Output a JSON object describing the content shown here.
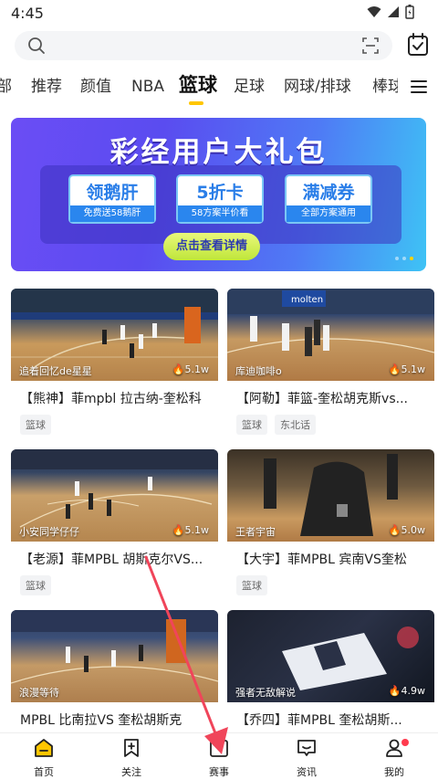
{
  "status_bar": {
    "time": "4:45"
  },
  "search": {
    "placeholder": ""
  },
  "tabs": [
    {
      "label": "部"
    },
    {
      "label": "推荐"
    },
    {
      "label": "颜值"
    },
    {
      "label": "NBA"
    },
    {
      "label": "篮球",
      "active": true
    },
    {
      "label": "足球"
    },
    {
      "label": "网球/排球"
    },
    {
      "label": "棒球"
    }
  ],
  "banner": {
    "title": "彩经用户大礼包",
    "coupons": [
      {
        "title": "领鹅肝",
        "subtitle": "免费送58鹅肝"
      },
      {
        "title": "5折卡",
        "subtitle": "58方案半价看"
      },
      {
        "title": "满减券",
        "subtitle": "全部方案通用"
      }
    ],
    "cta": "点击查看详情",
    "page_dots": 3,
    "active_dot": 2
  },
  "videos": [
    {
      "author": "追着回忆de星星",
      "views": "5.1w",
      "title": "【熊神】菲mpbl 拉古纳-奎松科",
      "tags": [
        "篮球"
      ]
    },
    {
      "author": "库迪咖啡o",
      "views": "5.1w",
      "title": "【阿勒】菲篮-奎松胡克斯vs...",
      "tags": [
        "篮球",
        "东北话"
      ]
    },
    {
      "author": "小安同学仔仔",
      "views": "5.1w",
      "title": "【老源】菲MPBL 胡斯克尔VS...",
      "tags": [
        "篮球"
      ]
    },
    {
      "author": "王者宇宙",
      "views": "5.0w",
      "title": "【大宇】菲MPBL 宾南VS奎松",
      "tags": [
        "篮球"
      ]
    },
    {
      "author": "浪漫等待",
      "views": "",
      "title": "MPBL 比南拉VS 奎松胡斯克",
      "tags": []
    },
    {
      "author": "强者无敌解说",
      "views": "4.9w",
      "title": "【乔四】菲MPBL 奎松胡斯...",
      "tags": []
    }
  ],
  "bottom_nav": [
    {
      "label": "首页",
      "icon": "home-icon"
    },
    {
      "label": "关注",
      "icon": "bookmark-plus-icon"
    },
    {
      "label": "赛事",
      "icon": "event-icon"
    },
    {
      "label": "资讯",
      "icon": "news-icon"
    },
    {
      "label": "我的",
      "icon": "profile-icon",
      "badge": true
    }
  ],
  "colors": {
    "accent": "#ffc600",
    "annotation_arrow": "#f0455a",
    "badge": "#ff3b4e"
  }
}
